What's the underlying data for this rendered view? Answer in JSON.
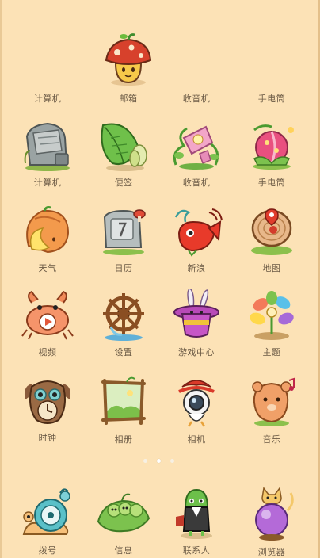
{
  "apps": [
    {
      "label": "计算机",
      "icon": "none"
    },
    {
      "label": "邮箱",
      "icon": "mushroom-mailbox-icon"
    },
    {
      "label": "收音机",
      "icon": "none"
    },
    {
      "label": "手电筒",
      "icon": "none"
    },
    {
      "label": "计算机",
      "icon": "stone-calculator-icon"
    },
    {
      "label": "便签",
      "icon": "leaf-note-icon"
    },
    {
      "label": "收音机",
      "icon": "morning-glory-radio-icon"
    },
    {
      "label": "手电筒",
      "icon": "flower-bud-flashlight-icon"
    },
    {
      "label": "天气",
      "icon": "moon-pumpkin-weather-icon"
    },
    {
      "label": "日历",
      "icon": "stone-calendar-icon"
    },
    {
      "label": "新浪",
      "icon": "red-fish-weibo-icon"
    },
    {
      "label": "地图",
      "icon": "tree-stump-map-icon"
    },
    {
      "label": "视频",
      "icon": "crab-video-icon"
    },
    {
      "label": "设置",
      "icon": "ship-wheel-settings-icon"
    },
    {
      "label": "游戏中心",
      "icon": "magic-hat-rabbit-icon"
    },
    {
      "label": "主题",
      "icon": "rainbow-flower-theme-icon"
    },
    {
      "label": "时钟",
      "icon": "owl-clock-icon"
    },
    {
      "label": "相册",
      "icon": "wooden-frame-album-icon"
    },
    {
      "label": "相机",
      "icon": "bird-camera-icon"
    },
    {
      "label": "音乐",
      "icon": "bear-music-icon"
    }
  ],
  "dock": [
    {
      "label": "拨号",
      "icon": "snail-phone-icon"
    },
    {
      "label": "信息",
      "icon": "pea-pod-message-icon"
    },
    {
      "label": "联系人",
      "icon": "green-dino-contacts-icon"
    },
    {
      "label": "浏览器",
      "icon": "cat-crystal-ball-browser-icon"
    }
  ],
  "pager": {
    "pages": 3,
    "active": 2
  }
}
